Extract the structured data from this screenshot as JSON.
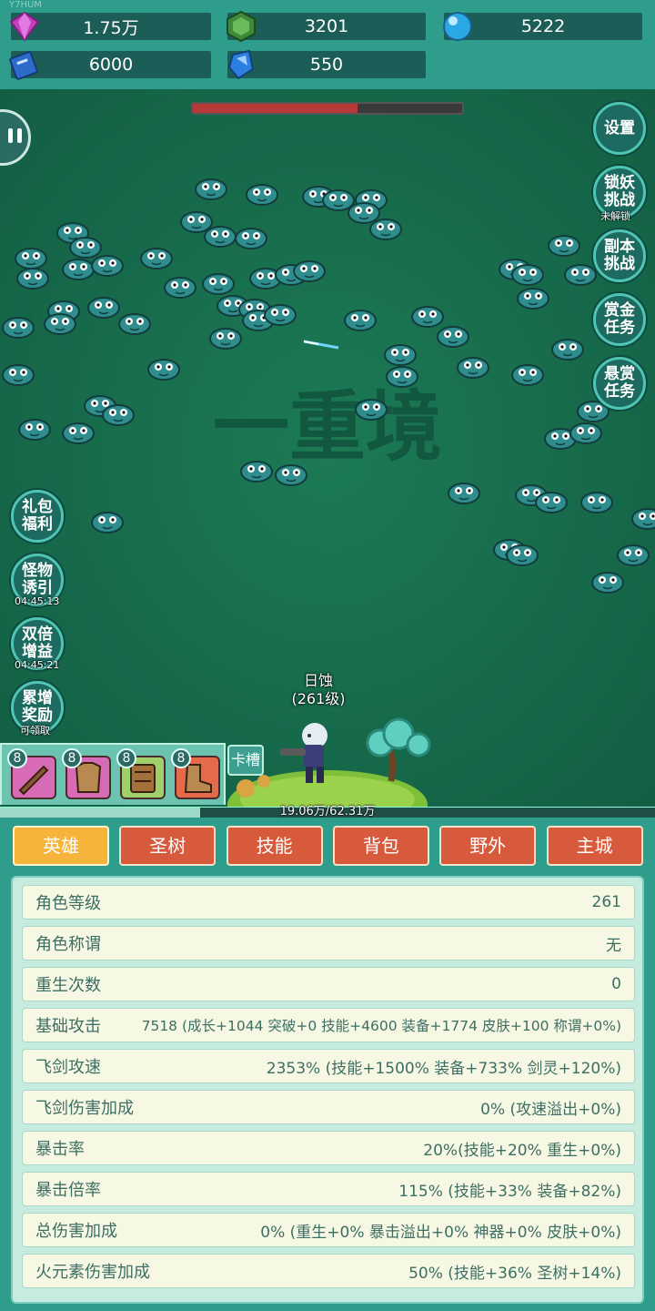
{
  "watermark": "Y7HUM",
  "resources": {
    "gems": "1.75万",
    "jade": "3201",
    "orbs": "5222",
    "books": "6000",
    "crystals": "550"
  },
  "boss_hp": 0.61,
  "stage_title": "一重境",
  "side_buttons": {
    "settings": "设置",
    "lock_demon": [
      "锁妖",
      "挑战"
    ],
    "lock_demon_note": "未解锁",
    "dungeon": [
      "副本",
      "挑战"
    ],
    "bounty": [
      "赏金",
      "任务"
    ],
    "reward": [
      "悬赏",
      "任务"
    ],
    "gift": [
      "礼包",
      "福利"
    ],
    "lure": [
      "怪物",
      "诱引"
    ],
    "lure_timer": "04:45:13",
    "double": [
      "双倍",
      "增益"
    ],
    "double_timer": "04:45:21",
    "accum": [
      "累增",
      "奖励"
    ],
    "accum_note": "可领取"
  },
  "hero": {
    "name": "日蚀",
    "level": "(261级)"
  },
  "skills": [
    "8",
    "8",
    "8",
    "8"
  ],
  "card_slot": "卡槽",
  "exp": {
    "text": "19.06万/62.31万",
    "fraction": 0.306
  },
  "tabs": [
    "英雄",
    "圣树",
    "技能",
    "背包",
    "野外",
    "主城"
  ],
  "stats": [
    {
      "label": "角色等级",
      "value": "261"
    },
    {
      "label": "角色称谓",
      "value": "无"
    },
    {
      "label": "重生次数",
      "value": "0"
    },
    {
      "label": "基础攻击",
      "value": "7518 (成长+1044 突破+0 技能+4600 装备+1774 皮肤+100 称谓+0%)"
    },
    {
      "label": "飞剑攻速",
      "value": "2353% (技能+1500% 装备+733% 剑灵+120%)"
    },
    {
      "label": "飞剑伤害加成",
      "value": "0% (攻速溢出+0%)"
    },
    {
      "label": "暴击率",
      "value": "20%(技能+20% 重生+0%)"
    },
    {
      "label": "暴击倍率",
      "value": "115% (技能+33% 装备+82%)"
    },
    {
      "label": "总伤害加成",
      "value": "0% (重生+0% 暴击溢出+0% 神器+0% 皮肤+0%)"
    },
    {
      "label": "火元素伤害加成",
      "value": "50% (技能+36% 圣树+14%)"
    }
  ],
  "colors": {
    "panel": "#2e9d8c",
    "tab": "#d85a3c",
    "tab_active": "#f6b53a",
    "row_bg": "#f6f8e4",
    "text": "#3d6e63"
  }
}
